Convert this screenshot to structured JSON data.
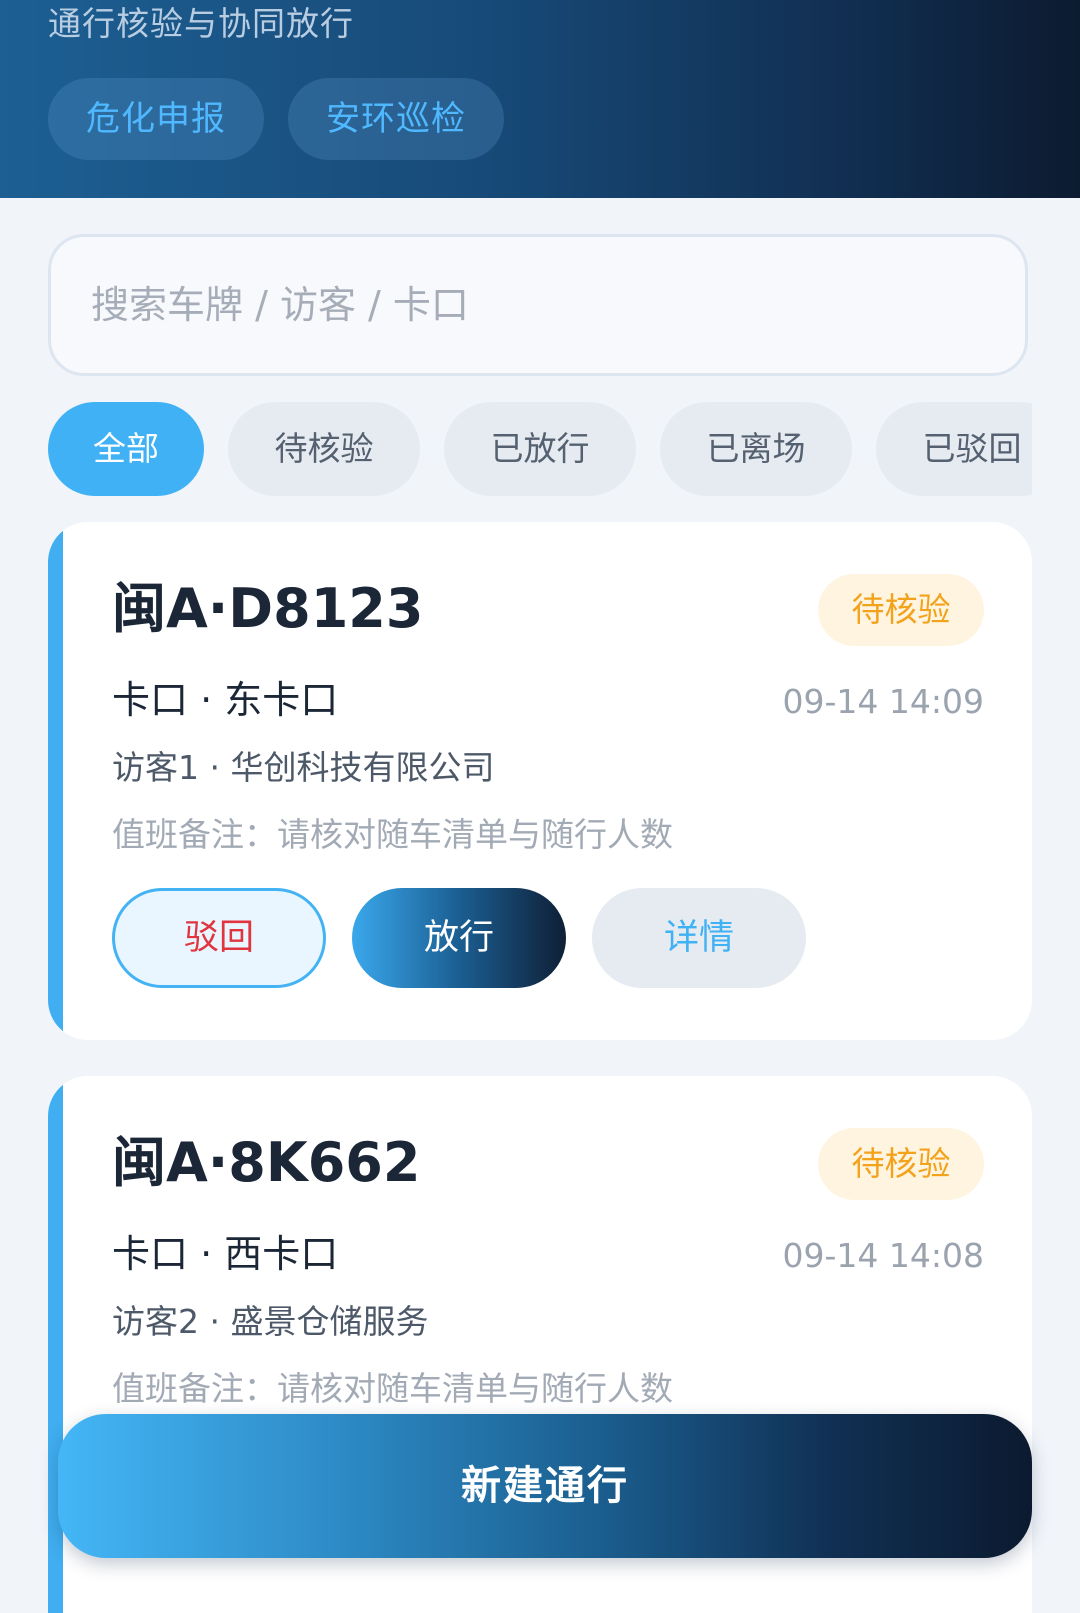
{
  "header": {
    "subtitle": "通行核验与协同放行",
    "chips": [
      "危化申报",
      "安环巡检"
    ]
  },
  "search": {
    "placeholder": "搜索车牌 / 访客 / 卡口",
    "value": ""
  },
  "filters": {
    "selected": "全部",
    "items": [
      "全部",
      "待核验",
      "已放行",
      "已离场",
      "已驳回"
    ]
  },
  "records": [
    {
      "plate": "闽A·D8123",
      "status": "待核验",
      "gate": "卡口 · 东卡口",
      "time": "09-14 14:09",
      "visitor": "访客1 · 华创科技有限公司",
      "note": "值班备注：请核对随车清单与随行人数",
      "actions": [
        "驳回",
        "放行",
        "详情"
      ]
    },
    {
      "plate": "闽A·8K662",
      "status": "待核验",
      "gate": "卡口 · 西卡口",
      "time": "09-14 14:08",
      "visitor": "访客2 · 盛景仓储服务",
      "note": "值班备注：请核对随车清单与随行人数"
    }
  ],
  "new_button": "新建通行",
  "colors": {
    "accent": "#3fb1f4",
    "pending_badge_text": "#f3a21c",
    "pending_badge_bg": "#fff4df",
    "reject_text": "#e0343f",
    "header_dark": "#0c1b30"
  }
}
